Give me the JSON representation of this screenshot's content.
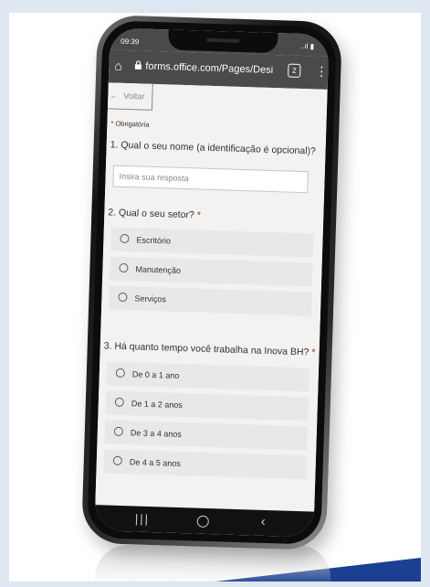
{
  "status": {
    "time": "09:39",
    "signal": "..ıl ▮"
  },
  "browser": {
    "url": "forms.office.com/Pages/Desig",
    "tab_count": "2"
  },
  "nav": {
    "back_label": "Voltar"
  },
  "form": {
    "required_star": "*",
    "required_note": "Obrigatória",
    "q1": {
      "title": "1. Qual o seu nome (a identificação é opcional)?",
      "placeholder": "Insira sua resposta"
    },
    "q2": {
      "title": "2. Qual o seu setor?",
      "options": [
        "Escritório",
        "Manutenção",
        "Serviços"
      ]
    },
    "q3": {
      "title": "3. Há quanto tempo você trabalha na Inova BH?",
      "options": [
        "De 0 a 1 ano",
        "De 1 a 2 anos",
        "De 3 a 4 anos",
        "De 4 a 5 anos"
      ]
    }
  },
  "icons": {
    "home": "⌂",
    "lock": "🔒",
    "menu": "⋮",
    "arrow": "←",
    "recent": "|||",
    "back_nav": "‹"
  },
  "colors": {
    "accent": "#a4262c",
    "browser_bar": "#4a4a4a",
    "corner": "#1a3f93"
  }
}
